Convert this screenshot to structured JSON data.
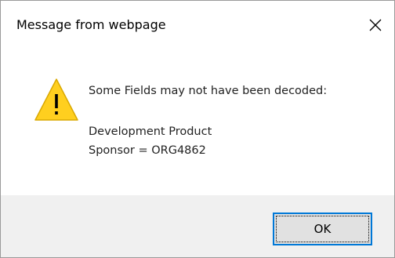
{
  "dialog": {
    "title": "Message from webpage",
    "close_icon": "close-icon",
    "icon": "warning-icon",
    "message_line_1": "Some Fields may not have been decoded:",
    "message_line_2": "Development Product",
    "message_line_3": "Sponsor = ORG4862",
    "ok_label": "OK"
  },
  "colors": {
    "warning_fill": "#ffcf1f",
    "focus_border": "#0078d7",
    "footer_background": "#f0f0f0"
  }
}
